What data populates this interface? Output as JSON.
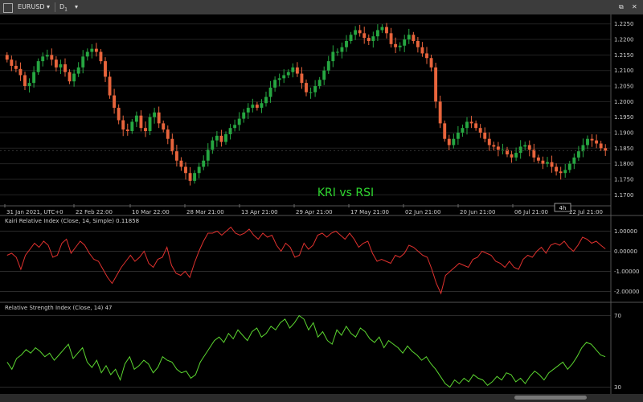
{
  "toolbar": {
    "symbol": "EURUSD",
    "timeframe": "D",
    "timeframe_sub": "1"
  },
  "overlay_title": "KRI vs RSI",
  "colors": {
    "bull": "#26a641",
    "bear": "#e8643c",
    "kri": "#e0312e",
    "rsi": "#5bd630",
    "grid": "#222",
    "axis_text": "#cfcfcf",
    "title": "#2fd62f"
  },
  "price_panel": {
    "y_labels": [
      "1.2250",
      "1.2200",
      "1.2150",
      "1.2100",
      "1.2050",
      "1.2000",
      "1.1950",
      "1.1900",
      "1.1850",
      "1.1800",
      "1.1750",
      "1.1700"
    ],
    "x_labels": [
      "31 Jan 2021, UTC+0",
      "22 Feb 22:00",
      "10 Mar 22:00",
      "28 Mar 21:00",
      "13 Apr 21:00",
      "29 Apr 21:00",
      "17 May 21:00",
      "02 Jun 21:00",
      "20 Jun 21:00",
      "06 Jul 21:00",
      "22 Jul 21:00"
    ],
    "badge": "4h"
  },
  "kri_panel": {
    "label": "Kairi Relative Index (Close, 14, Simple) 0.11858",
    "y_labels": [
      "1.00000",
      "0.00000",
      "-1.00000",
      "-2.00000"
    ]
  },
  "rsi_panel": {
    "label": "Relative Strength Index (Close, 14) 47",
    "y_labels": [
      "70",
      "30"
    ]
  },
  "chart_data": [
    {
      "type": "candlestick",
      "title": "EURUSD, D1",
      "ylim": [
        1.168,
        1.227
      ],
      "close": [
        1.2135,
        1.2115,
        1.2105,
        1.2085,
        1.205,
        1.206,
        1.2095,
        1.213,
        1.2145,
        1.215,
        1.2135,
        1.211,
        1.212,
        1.2095,
        1.2065,
        1.209,
        1.211,
        1.2145,
        1.216,
        1.217,
        1.216,
        1.213,
        1.208,
        1.202,
        1.198,
        1.194,
        1.191,
        1.1905,
        1.1935,
        1.1955,
        1.1915,
        1.1905,
        1.195,
        1.1965,
        1.193,
        1.191,
        1.188,
        1.184,
        1.181,
        1.179,
        1.177,
        1.1745,
        1.177,
        1.179,
        1.181,
        1.1845,
        1.1875,
        1.189,
        1.187,
        1.1895,
        1.1915,
        1.1925,
        1.1945,
        1.1965,
        1.198,
        1.199,
        1.198,
        1.1995,
        1.2015,
        1.2045,
        1.207,
        1.2075,
        1.2085,
        1.2095,
        1.211,
        1.209,
        1.206,
        1.203,
        1.203,
        1.205,
        1.207,
        1.21,
        1.213,
        1.216,
        1.216,
        1.2175,
        1.2195,
        1.2215,
        1.223,
        1.222,
        1.2205,
        1.2195,
        1.221,
        1.223,
        1.224,
        1.222,
        1.2185,
        1.2175,
        1.218,
        1.22,
        1.2215,
        1.2195,
        1.2175,
        1.2155,
        1.214,
        1.211,
        1.2,
        1.193,
        1.188,
        1.186,
        1.188,
        1.19,
        1.1915,
        1.1935,
        1.193,
        1.1915,
        1.19,
        1.188,
        1.186,
        1.1855,
        1.1845,
        1.1845,
        1.183,
        1.182,
        1.1835,
        1.1855,
        1.186,
        1.1845,
        1.182,
        1.181,
        1.18,
        1.1805,
        1.179,
        1.1775,
        1.177,
        1.178,
        1.18,
        1.182,
        1.184,
        1.186,
        1.188,
        1.1875,
        1.1865,
        1.185,
        1.1842
      ],
      "series": [
        {
          "name": "Kairi Relative Index (Close, 14, Simple)",
          "type": "line",
          "last": 0.11858,
          "ylim": [
            -2.3,
            1.3
          ],
          "values": [
            -0.2,
            -0.1,
            -0.3,
            -0.9,
            -0.2,
            0.1,
            0.4,
            0.2,
            0.5,
            0.3,
            -0.3,
            -0.2,
            0.4,
            0.6,
            -0.1,
            0.2,
            0.5,
            0.3,
            -0.1,
            -0.4,
            -0.5,
            -0.9,
            -1.3,
            -1.6,
            -1.2,
            -0.8,
            -0.5,
            -0.2,
            -0.5,
            -0.3,
            0.0,
            -0.6,
            -0.8,
            -0.4,
            -0.3,
            0.2,
            -0.7,
            -1.1,
            -1.2,
            -1.0,
            -1.3,
            -0.6,
            0.0,
            0.5,
            0.9,
            0.9,
            1.0,
            0.8,
            1.0,
            1.2,
            0.9,
            0.8,
            0.9,
            1.1,
            0.8,
            0.6,
            0.9,
            0.7,
            0.8,
            0.3,
            0.0,
            0.4,
            0.2,
            -0.3,
            -0.2,
            0.4,
            0.1,
            0.3,
            0.8,
            0.9,
            0.7,
            0.9,
            1.0,
            0.8,
            0.6,
            0.9,
            0.6,
            0.2,
            0.4,
            0.5,
            -0.1,
            -0.5,
            -0.4,
            -0.5,
            -0.6,
            -0.2,
            -0.3,
            -0.1,
            0.3,
            0.2,
            0.0,
            -0.2,
            -0.3,
            -0.9,
            -1.6,
            -2.1,
            -1.2,
            -1.0,
            -0.8,
            -0.6,
            -0.7,
            -0.8,
            -0.4,
            -0.3,
            0.0,
            -0.1,
            -0.2,
            -0.5,
            -0.6,
            -0.8,
            -0.5,
            -0.8,
            -0.9,
            -0.4,
            -0.2,
            -0.3,
            0.0,
            0.2,
            -0.1,
            0.3,
            0.4,
            0.3,
            0.5,
            0.2,
            0.0,
            0.3,
            0.7,
            0.6,
            0.4,
            0.5,
            0.3,
            0.12
          ]
        },
        {
          "name": "Relative Strength Index (Close, 14)",
          "type": "line",
          "last": 47,
          "ylim": [
            28,
            72
          ],
          "values": [
            44,
            40,
            46,
            48,
            51,
            49,
            52,
            50,
            47,
            49,
            45,
            48,
            51,
            54,
            46,
            49,
            52,
            44,
            41,
            45,
            38,
            42,
            37,
            40,
            34,
            43,
            47,
            40,
            42,
            45,
            43,
            38,
            41,
            47,
            45,
            44,
            40,
            38,
            39,
            35,
            37,
            44,
            48,
            52,
            56,
            58,
            55,
            60,
            57,
            62,
            59,
            56,
            61,
            63,
            58,
            60,
            64,
            62,
            66,
            68,
            63,
            66,
            70,
            68,
            62,
            66,
            58,
            61,
            56,
            54,
            62,
            59,
            64,
            60,
            58,
            63,
            61,
            57,
            55,
            58,
            52,
            56,
            54,
            52,
            49,
            53,
            50,
            48,
            45,
            47,
            43,
            40,
            36,
            32,
            30,
            34,
            32,
            35,
            33,
            37,
            35,
            34,
            31,
            33,
            36,
            34,
            38,
            37,
            33,
            35,
            32,
            36,
            39,
            37,
            34,
            38,
            40,
            42,
            44,
            40,
            43,
            47,
            52,
            55,
            54,
            51,
            48,
            47
          ]
        }
      ]
    }
  ]
}
